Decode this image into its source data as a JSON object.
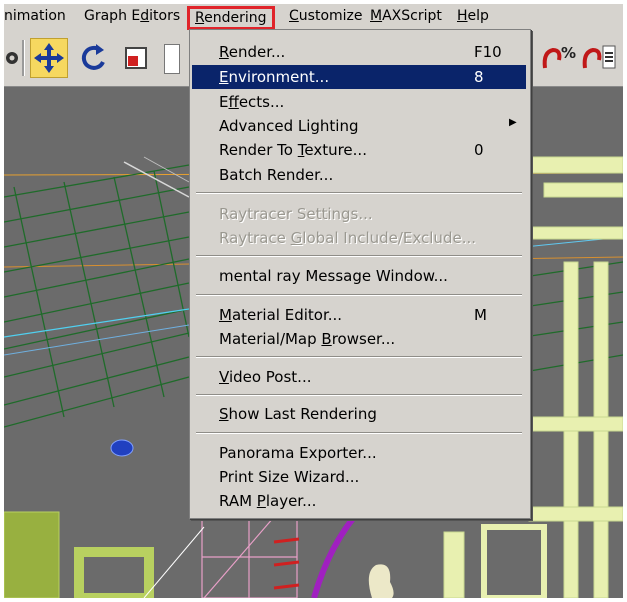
{
  "menubar": {
    "items": [
      {
        "pre": "nimation",
        "acc": "",
        "post": ""
      },
      {
        "pre": "Graph E",
        "acc": "d",
        "post": "itors"
      },
      {
        "pre": "",
        "acc": "R",
        "post": "endering"
      },
      {
        "pre": "",
        "acc": "C",
        "post": "ustomize"
      },
      {
        "pre": "",
        "acc": "M",
        "post": "AXScript"
      },
      {
        "pre": "",
        "acc": "H",
        "post": "elp"
      }
    ]
  },
  "toolbar": {
    "icons": [
      "select-move-icon",
      "rotate-icon",
      "scale-icon",
      "percent-snap-icon",
      "spinner-snap-icon"
    ]
  },
  "rendering_menu": {
    "items": [
      {
        "pre": "",
        "acc": "R",
        "post": "ender...",
        "shortcut": "F10",
        "state": "normal"
      },
      {
        "pre": "",
        "acc": "E",
        "post": "nvironment...",
        "shortcut": "8",
        "state": "highlighted"
      },
      {
        "pre": "E",
        "acc": "f",
        "post": "fects...",
        "shortcut": "",
        "state": "normal"
      },
      {
        "pre": "Advanced Lighting",
        "acc": "",
        "post": "",
        "shortcut": "",
        "state": "submenu"
      },
      {
        "pre": "Render To ",
        "acc": "T",
        "post": "exture...",
        "shortcut": "0",
        "state": "normal"
      },
      {
        "pre": "Batch Render...",
        "acc": "",
        "post": "",
        "shortcut": "",
        "state": "normal"
      },
      {
        "pre": "Raytracer Settings...",
        "acc": "",
        "post": "",
        "shortcut": "",
        "state": "disabled"
      },
      {
        "pre": "Raytrace ",
        "acc": "G",
        "post": "lobal Include/Exclude...",
        "shortcut": "",
        "state": "disabled"
      },
      {
        "pre": "mental ray Message Window...",
        "acc": "",
        "post": "",
        "shortcut": "",
        "state": "normal"
      },
      {
        "pre": "",
        "acc": "M",
        "post": "aterial Editor...",
        "shortcut": "M",
        "state": "normal"
      },
      {
        "pre": "Material/Map ",
        "acc": "B",
        "post": "rowser...",
        "shortcut": "",
        "state": "normal"
      },
      {
        "pre": "",
        "acc": "V",
        "post": "ideo Post...",
        "shortcut": "",
        "state": "normal"
      },
      {
        "pre": "",
        "acc": "S",
        "post": "how Last Rendering",
        "shortcut": "",
        "state": "normal"
      },
      {
        "pre": "Panorama Exporter...",
        "acc": "",
        "post": "",
        "shortcut": "",
        "state": "normal"
      },
      {
        "pre": "Print Size Wizard...",
        "acc": "",
        "post": "",
        "shortcut": "",
        "state": "normal"
      },
      {
        "pre": "RAM ",
        "acc": "P",
        "post": "layer...",
        "shortcut": "",
        "state": "normal"
      }
    ]
  },
  "colors": {
    "menu_bg": "#d6d3ce",
    "highlight": "#0a246a",
    "callout_box": "#e0242a",
    "viewport_bg": "#6b6b6b",
    "grid_green": "#1f6b2a",
    "wire_yellow": "#e8f0b0",
    "wire_pink": "#e8a0c8",
    "wire_purple": "#a020c0"
  }
}
